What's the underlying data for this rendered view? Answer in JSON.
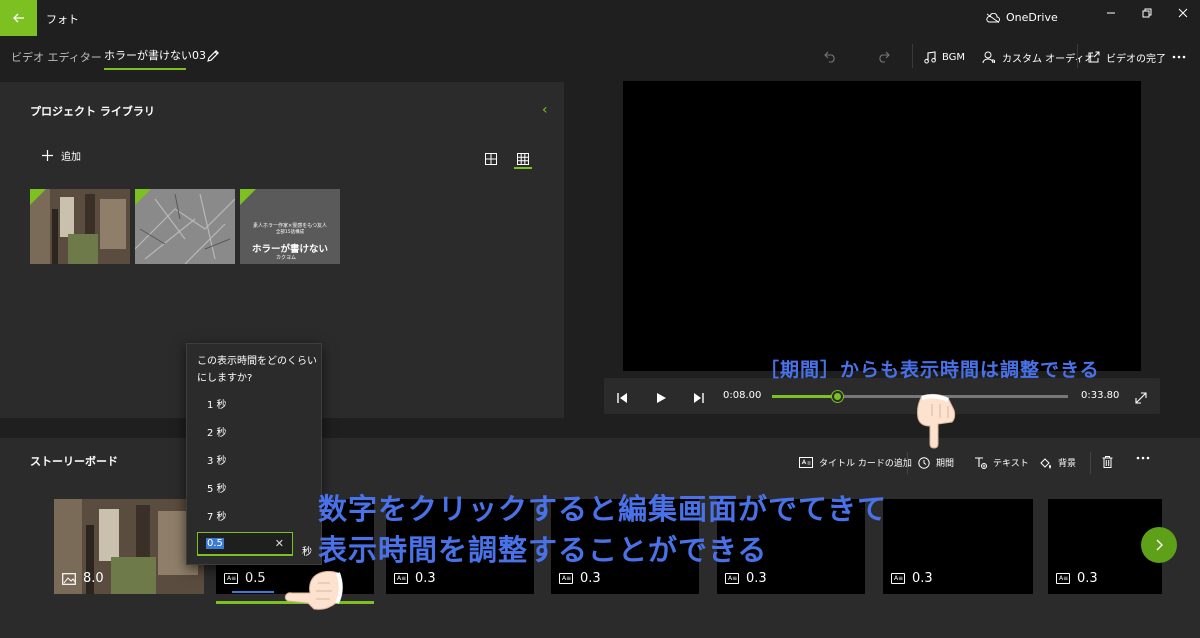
{
  "app": {
    "title": "フォト",
    "onedrive": "OneDrive"
  },
  "breadcrumb": {
    "root": "ビデオ エディター",
    "current": "ホラーが書けない03"
  },
  "toolbar": {
    "bgm": "BGM",
    "custom_audio": "カスタム オーディオ",
    "finish": "ビデオの完了"
  },
  "library": {
    "title": "プロジェクト ライブラリ",
    "add_label": "追加",
    "card_caption": "素人ホラー作家×霊感をもつ友人",
    "card_subcaption": "全部15話構成",
    "card_title": "ホラーが書けない",
    "card_author": "カクヨム"
  },
  "player": {
    "current_time": "0:08.00",
    "total_time": "0:33.80",
    "progress": 0.22
  },
  "storyboard": {
    "title": "ストーリーボード",
    "add_title_card": "タイトル カードの追加",
    "duration": "期間",
    "text": "テキスト",
    "background": "背景",
    "clips": [
      {
        "value": "8.0",
        "type": "image"
      },
      {
        "value": "0.5",
        "type": "title"
      },
      {
        "value": "0.3",
        "type": "title"
      },
      {
        "value": "0.3",
        "type": "title"
      },
      {
        "value": "0.3",
        "type": "title"
      },
      {
        "value": "0.3",
        "type": "title"
      },
      {
        "value": "0.3",
        "type": "title"
      }
    ]
  },
  "flyout": {
    "question": "この表示時間をどのくらいにしますか?",
    "options": [
      "1 秒",
      "2 秒",
      "3 秒",
      "5 秒",
      "7 秒"
    ],
    "input_value": "0.5",
    "unit": "秒"
  },
  "annotations": {
    "top": "［期間］からも表示時間は調整できる",
    "line1": "数字をクリックすると編集画面がでてきて",
    "line2": "表示時間を調整することができる"
  },
  "colors": {
    "accent": "#7cc121",
    "annotation": "#4a72e8",
    "panel": "#2b2b2b",
    "background": "#1f1f1f"
  }
}
